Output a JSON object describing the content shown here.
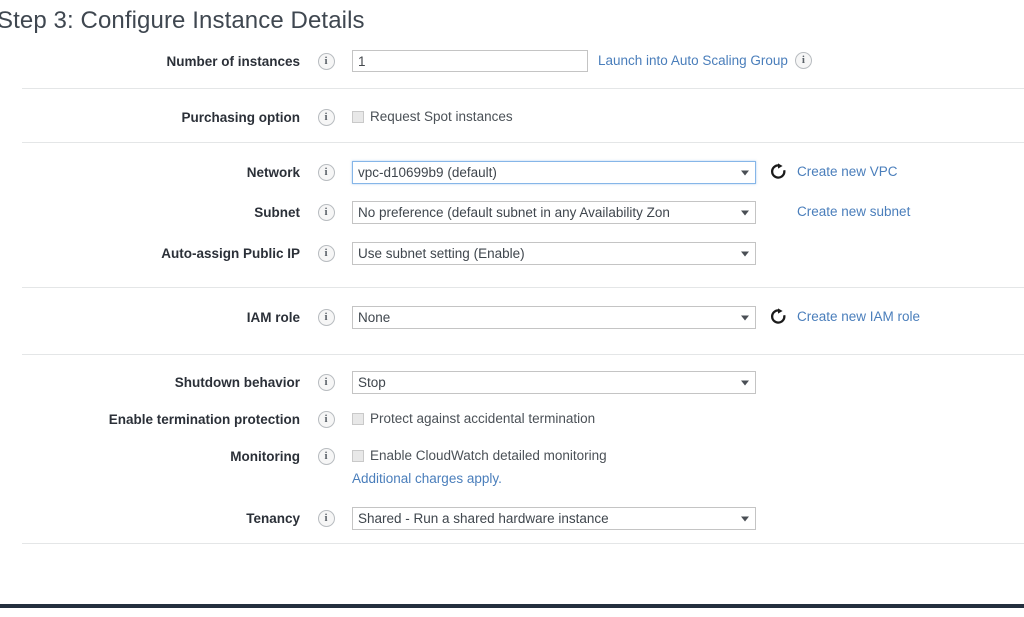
{
  "page": {
    "title": "Step 3: Configure Instance Details"
  },
  "icons": {
    "info": "info-icon",
    "refresh": "refresh-icon",
    "dropdown_arrow": "chevron-down-icon",
    "checkbox": "checkbox-icon"
  },
  "colors": {
    "link": "#4a7ebb",
    "label": "#2b3038",
    "title": "#3f4750",
    "divider": "#e4e6e7",
    "footer_rule": "#242f3e",
    "focus_border": "#86b6e8"
  },
  "fields": {
    "number_of_instances": {
      "label": "Number of instances",
      "value": "1",
      "placeholder": "",
      "link": "Launch into Auto Scaling Group"
    },
    "purchasing_option": {
      "label": "Purchasing option",
      "checkbox_label": "Request Spot instances",
      "checked": false
    },
    "network": {
      "label": "Network",
      "value": "vpc-d10699b9 (default)",
      "link": "Create new VPC",
      "focused": true
    },
    "subnet": {
      "label": "Subnet",
      "value": "No preference (default subnet in any Availability Zon",
      "link": "Create new subnet"
    },
    "auto_assign_public_ip": {
      "label": "Auto-assign Public IP",
      "value": "Use subnet setting (Enable)"
    },
    "iam_role": {
      "label": "IAM role",
      "value": "None",
      "link": "Create new IAM role"
    },
    "shutdown_behavior": {
      "label": "Shutdown behavior",
      "value": "Stop"
    },
    "termination_protection": {
      "label": "Enable termination protection",
      "checkbox_label": "Protect against accidental termination",
      "checked": false
    },
    "monitoring": {
      "label": "Monitoring",
      "checkbox_label": "Enable CloudWatch detailed monitoring",
      "checked": false,
      "link": "Additional charges apply."
    },
    "tenancy": {
      "label": "Tenancy",
      "value": "Shared - Run a shared hardware instance"
    }
  }
}
